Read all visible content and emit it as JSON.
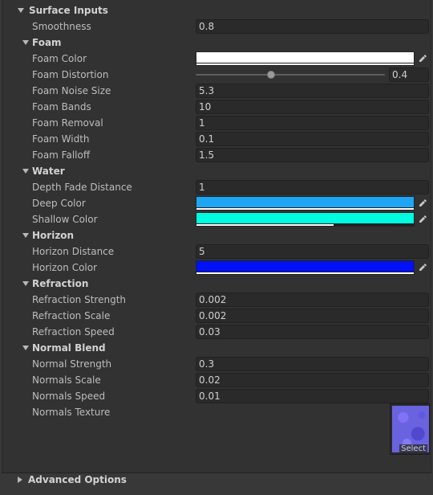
{
  "surface_inputs": {
    "title": "Surface Inputs",
    "smoothness_label": "Smoothness",
    "smoothness_value": "0.8"
  },
  "foam": {
    "title": "Foam",
    "color_label": "Foam Color",
    "color_value": "#ffffff",
    "distortion_label": "Foam Distortion",
    "distortion_value": "0.4",
    "distortion_fraction": 0.4,
    "noise_size_label": "Foam Noise Size",
    "noise_size_value": "5.3",
    "bands_label": "Foam Bands",
    "bands_value": "10",
    "removal_label": "Foam Removal",
    "removal_value": "1",
    "width_label": "Foam Width",
    "width_value": "0.1",
    "falloff_label": "Foam Falloff",
    "falloff_value": "1.5"
  },
  "water": {
    "title": "Water",
    "depth_fade_label": "Depth Fade Distance",
    "depth_fade_value": "1",
    "deep_color_label": "Deep Color",
    "deep_color_value": "#1ea6f4",
    "deep_alpha": 1.0,
    "shallow_color_label": "Shallow Color",
    "shallow_color_value": "#00fce0",
    "shallow_alpha": 0.63
  },
  "horizon": {
    "title": "Horizon",
    "distance_label": "Horizon Distance",
    "distance_value": "5",
    "color_label": "Horizon Color",
    "color_value": "#0011f5",
    "color_alpha": 1.0
  },
  "refraction": {
    "title": "Refraction",
    "strength_label": "Refraction Strength",
    "strength_value": "0.002",
    "scale_label": "Refraction Scale",
    "scale_value": "0.002",
    "speed_label": "Refraction Speed",
    "speed_value": "0.03"
  },
  "normal_blend": {
    "title": "Normal Blend",
    "strength_label": "Normal Strength",
    "strength_value": "0.3",
    "scale_label": "Normals Scale",
    "scale_value": "0.02",
    "speed_label": "Normals Speed",
    "speed_value": "0.01",
    "texture_label": "Normals Texture",
    "texture_select_label": "Select"
  },
  "advanced": {
    "title": "Advanced Options"
  }
}
